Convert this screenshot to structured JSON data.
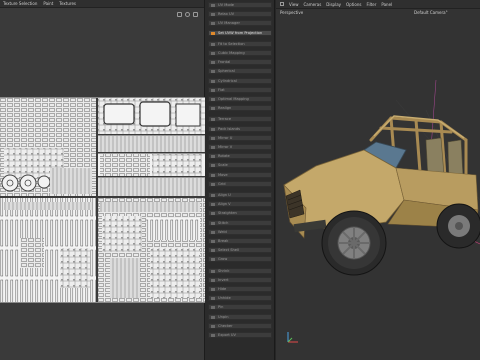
{
  "uv_editor": {
    "menu": [
      "Texture Selection",
      "Paint",
      "Textures"
    ]
  },
  "tool_list": {
    "items": [
      {
        "label": "UV Mode",
        "active": false
      },
      {
        "label": "Relax UV",
        "active": false
      },
      {
        "label": "UV Manager",
        "active": false
      },
      {
        "label": "Set UVW from Projection",
        "active": true
      },
      {
        "label": "Fit to Selection",
        "active": false
      },
      {
        "label": "Cubic Mapping",
        "active": false
      },
      {
        "label": "Frontal",
        "active": false
      },
      {
        "label": "Spherical",
        "active": false
      },
      {
        "label": "Cylindrical",
        "active": false
      },
      {
        "label": "Flat",
        "active": false
      },
      {
        "label": "Optimal Mapping",
        "active": false
      },
      {
        "label": "Realign",
        "active": false
      },
      {
        "label": "Terrace",
        "active": false
      },
      {
        "label": "Pack Islands",
        "active": false
      },
      {
        "label": "Mirror U",
        "active": false
      },
      {
        "label": "Mirror V",
        "active": false
      },
      {
        "label": "Rotate",
        "active": false
      },
      {
        "label": "Scale",
        "active": false
      },
      {
        "label": "Move",
        "active": false
      },
      {
        "label": "Grid",
        "active": false
      },
      {
        "label": "Align U",
        "active": false
      },
      {
        "label": "Align V",
        "active": false
      },
      {
        "label": "Straighten",
        "active": false
      },
      {
        "label": "Stitch",
        "active": false
      },
      {
        "label": "Weld",
        "active": false
      },
      {
        "label": "Break",
        "active": false
      },
      {
        "label": "Select Shell",
        "active": false
      },
      {
        "label": "Grow",
        "active": false
      },
      {
        "label": "Shrink",
        "active": false
      },
      {
        "label": "Invert",
        "active": false
      },
      {
        "label": "Hide",
        "active": false
      },
      {
        "label": "Unhide",
        "active": false
      },
      {
        "label": "Pin",
        "active": false
      },
      {
        "label": "Unpin",
        "active": false
      },
      {
        "label": "Checker",
        "active": false
      },
      {
        "label": "Export UV",
        "active": false
      }
    ]
  },
  "viewport": {
    "menu": [
      "View",
      "Cameras",
      "Display",
      "Options",
      "Filter",
      "Panel"
    ],
    "view_name": "Perspective",
    "camera_name": "Default Camera",
    "camera_marker": "°"
  },
  "colors": {
    "vehicle_body": "#c4a86a",
    "active_accent": "#e08a2c"
  }
}
